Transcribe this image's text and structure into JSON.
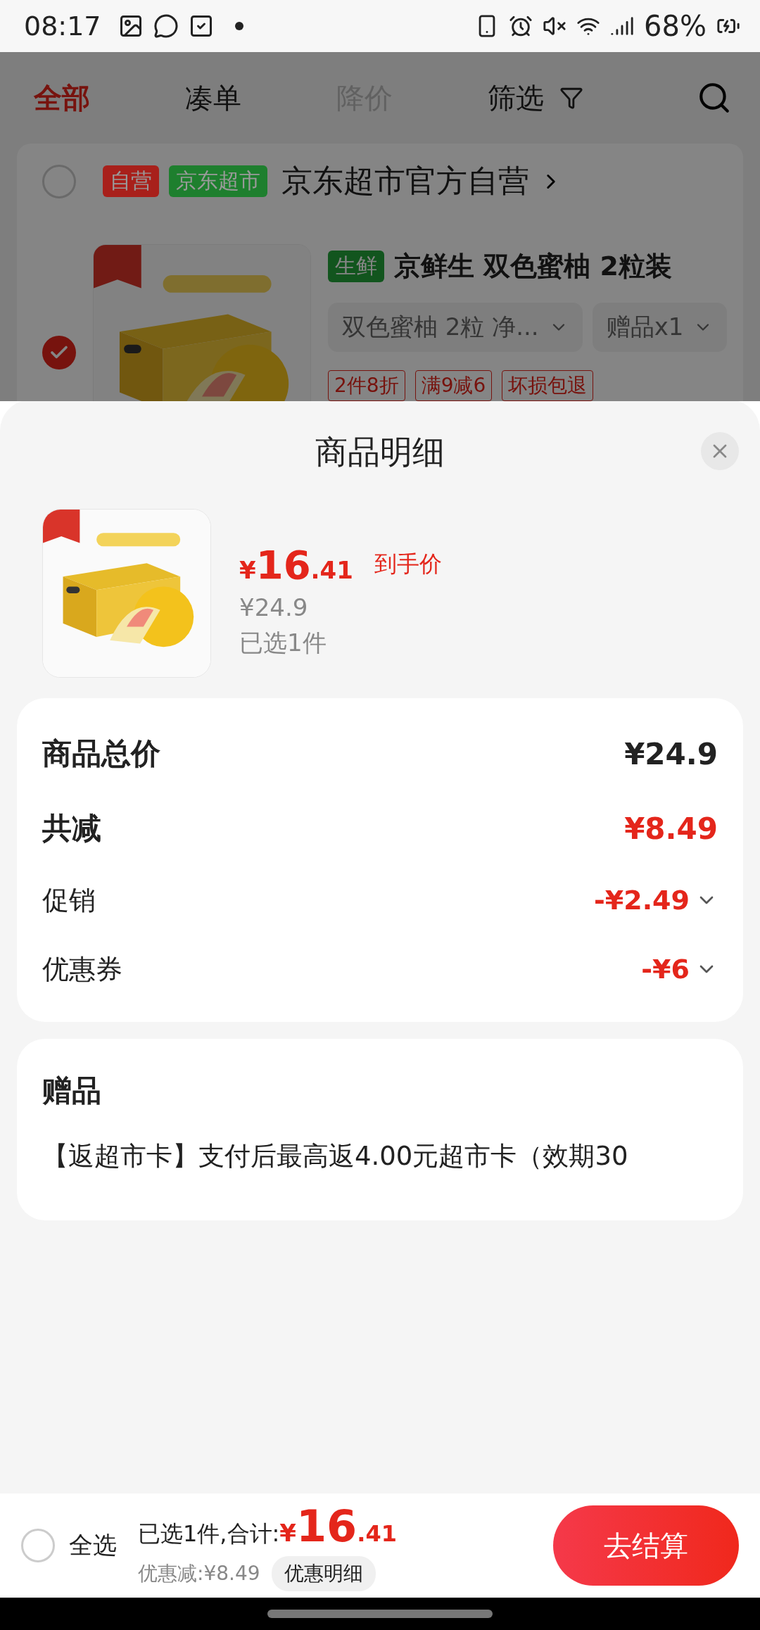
{
  "status_bar": {
    "time": "08:17",
    "battery": "68%"
  },
  "filter_tabs": [
    {
      "label": "全部",
      "kind": "tab",
      "selected": true,
      "disabled": false
    },
    {
      "label": "凑单",
      "kind": "tab",
      "selected": false,
      "disabled": false
    },
    {
      "label": "降价",
      "kind": "tab",
      "selected": false,
      "disabled": true
    },
    {
      "label": "筛选",
      "kind": "filter",
      "selected": false,
      "disabled": false
    }
  ],
  "store": {
    "checked": false,
    "badges": [
      {
        "label": "自营",
        "color": "#a8201b"
      },
      {
        "label": "京东超市",
        "color": "#1e7f2e"
      }
    ],
    "name": "京东超市官方自营"
  },
  "product": {
    "checked": true,
    "category_tag": "生鲜",
    "title": "京鲜生 双色蜜柚 2粒装",
    "variants": [
      "双色蜜柚 2粒 净...",
      "赠品x1"
    ],
    "promo_tags": [
      "2件8折",
      "满9减6",
      "坏损包退"
    ]
  },
  "sheet": {
    "title": "商品明细",
    "item": {
      "price_symbol": "¥",
      "price_int": "16",
      "price_dec": ".41",
      "price_label": "到手价",
      "original_price": "¥24.9",
      "selected_count": "已选1件"
    },
    "summary": [
      {
        "label": "商品总价",
        "value": "¥24.9",
        "kind": "total"
      },
      {
        "label": "共减",
        "value": "¥8.49",
        "kind": "discount_total"
      },
      {
        "label": "促销",
        "value": "-¥2.49",
        "kind": "detail"
      },
      {
        "label": "优惠券",
        "value": "-¥6",
        "kind": "detail"
      }
    ],
    "gifts": {
      "title": "赠品",
      "text": "【返超市卡】支付后最高返4.00元超市卡（效期30"
    }
  },
  "bottom_bar": {
    "select_all": {
      "label": "全选",
      "checked": false
    },
    "selected_text": "已选1件,合计:",
    "total_symbol": "¥",
    "total_int": "16",
    "total_dec": ".41",
    "discount": "优惠减:¥8.49",
    "detail_button": "优惠明细",
    "checkout": "去结算"
  }
}
